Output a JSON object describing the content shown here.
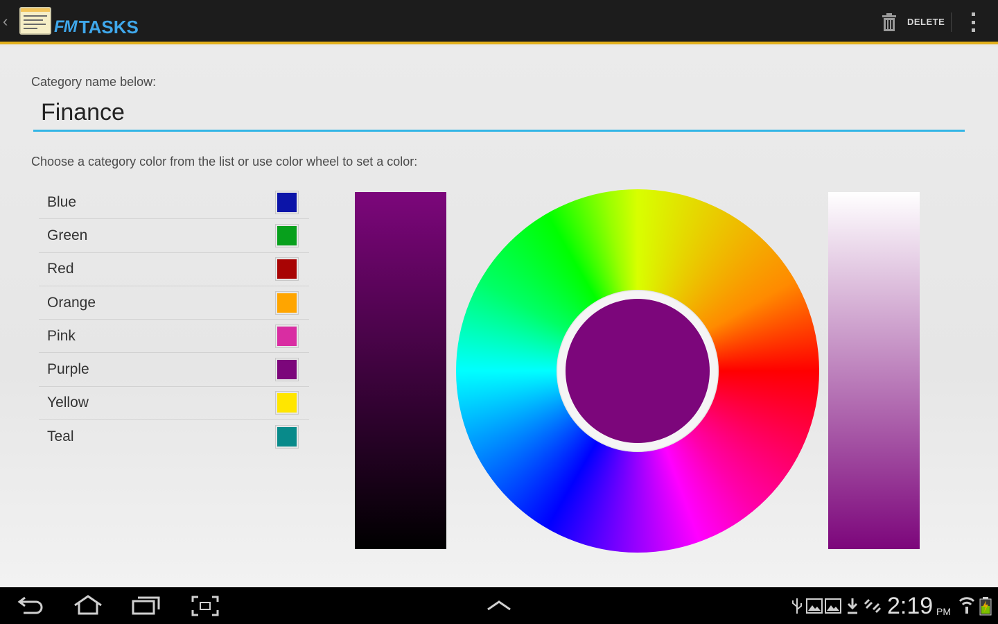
{
  "action_bar": {
    "app_title_prefix": "FM",
    "app_title": "TASKS",
    "delete_label": "DELETE",
    "accent_color": "#e2b01c"
  },
  "form": {
    "name_label": "Category name below:",
    "name_value": "Finance",
    "color_label": "Choose a category color from the list or use color wheel to set a color:"
  },
  "colors": [
    {
      "name": "Blue",
      "hex": "#0b14a8"
    },
    {
      "name": "Green",
      "hex": "#07a01c"
    },
    {
      "name": "Red",
      "hex": "#a80404"
    },
    {
      "name": "Orange",
      "hex": "#ffa500"
    },
    {
      "name": "Pink",
      "hex": "#d92da2"
    },
    {
      "name": "Purple",
      "hex": "#7c067b"
    },
    {
      "name": "Yellow",
      "hex": "#ffe600"
    },
    {
      "name": "Teal",
      "hex": "#088a8a"
    }
  ],
  "picker": {
    "selected_color": "#7c067b"
  },
  "system_bar": {
    "time": "2:19",
    "ampm": "PM",
    "icons": [
      "back-icon",
      "home-icon",
      "recent-apps-icon",
      "screenshot-icon",
      "up-chevron-icon",
      "usb-icon",
      "gallery-icon",
      "gallery-icon",
      "download-icon",
      "sync-icon",
      "wifi-icon",
      "battery-icon"
    ]
  }
}
